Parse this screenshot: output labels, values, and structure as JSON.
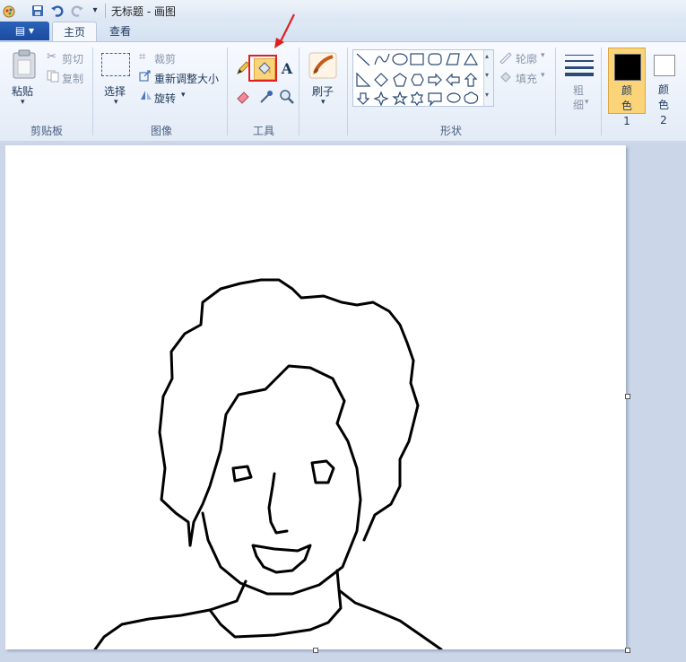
{
  "window": {
    "title": "无标题 - 画图"
  },
  "tabs": {
    "file": "▤ ▾",
    "home": "主页",
    "view": "查看"
  },
  "clipboard": {
    "paste": "粘贴",
    "cut": "剪切",
    "copy": "复制",
    "label": "剪贴板"
  },
  "image": {
    "select": "选择",
    "crop": "裁剪",
    "resize": "重新调整大小",
    "rotate": "旋转",
    "label": "图像"
  },
  "tools": {
    "label": "工具",
    "text_icon": "A"
  },
  "brush": {
    "label": "刷子"
  },
  "shapes": {
    "outline": "轮廓",
    "fill": "填充",
    "label": "形状"
  },
  "size": {
    "label": "粗细"
  },
  "colors": {
    "color1": "颜色 1",
    "color2": "颜色 2",
    "color1_value": "#000000",
    "color2_value": "#ffffff"
  },
  "accent": {
    "highlight": "#e02020",
    "selected_color_bg": "#fbd47a"
  }
}
